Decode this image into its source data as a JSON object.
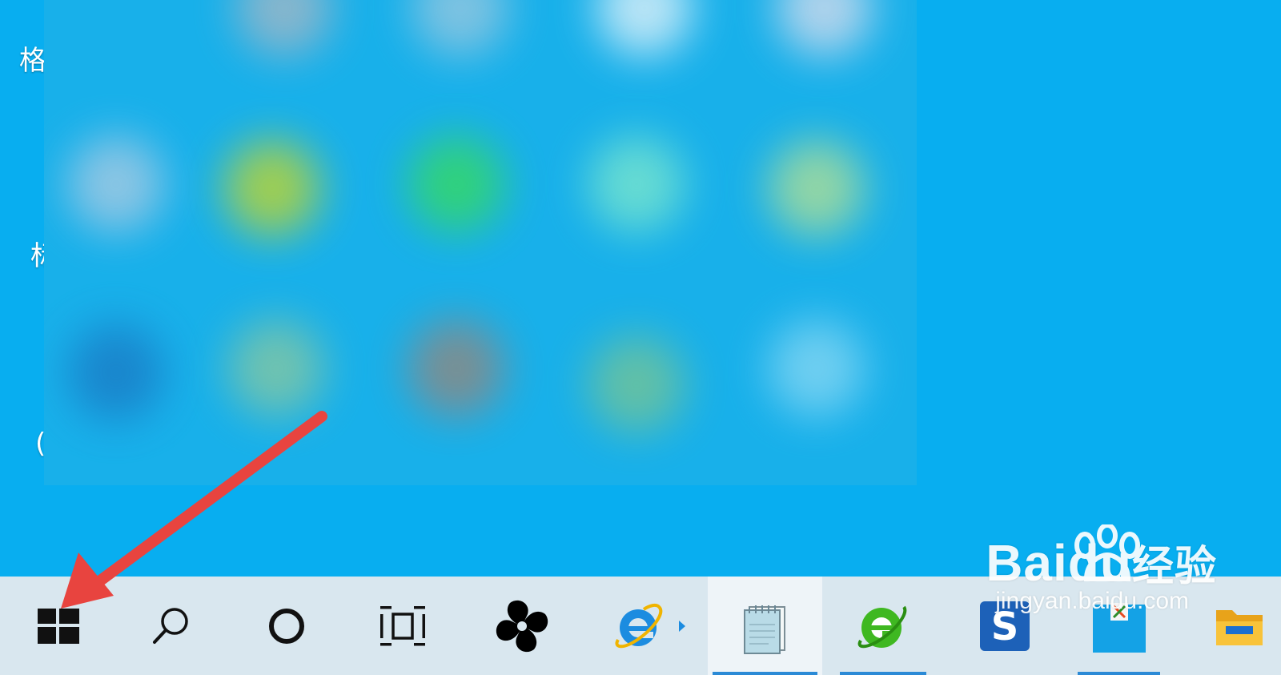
{
  "desktop": {
    "background": "#08aef0",
    "edge_labels": [
      "格",
      "标",
      "("
    ]
  },
  "taskbar": {
    "background": "#d9e7ef",
    "accent": "#2b8ad6",
    "items": [
      {
        "id": "start",
        "icon": "windows-start-icon"
      },
      {
        "id": "search",
        "icon": "search-icon"
      },
      {
        "id": "cortana",
        "icon": "cortana-circle-icon"
      },
      {
        "id": "task-view",
        "icon": "task-view-icon"
      },
      {
        "id": "app-pinwheel",
        "icon": "pinwheel-app-icon"
      },
      {
        "id": "internet-explorer",
        "icon": "internet-explorer-icon"
      },
      {
        "id": "notepad",
        "icon": "notepad-icon",
        "active": true
      },
      {
        "id": "browser-green-e",
        "icon": "green-e-browser-icon"
      },
      {
        "id": "app-blue-s",
        "icon": "blue-s-app-icon"
      },
      {
        "id": "app-blue-tile",
        "icon": "blue-tile-app-icon"
      },
      {
        "id": "file-explorer",
        "icon": "folder-icon"
      }
    ]
  },
  "annotation": {
    "arrow_color": "#e8443f",
    "arrow_target": "start"
  },
  "watermark": {
    "main": "Bai",
    "mid": "du",
    "cn": "经验",
    "sub": "jingyan.baidu.com"
  }
}
